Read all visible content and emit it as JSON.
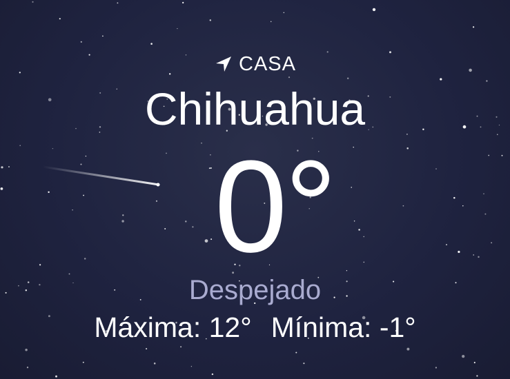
{
  "location": {
    "icon": "location-arrow-icon",
    "label": "CASA",
    "city": "Chihuahua"
  },
  "current": {
    "temperature": "0°",
    "condition": "Despejado"
  },
  "range": {
    "high": "Máxima: 12°",
    "low": "Mínima: -1°"
  },
  "colors": {
    "sky": "#1f2340",
    "condition_text": "#a9abd0"
  }
}
